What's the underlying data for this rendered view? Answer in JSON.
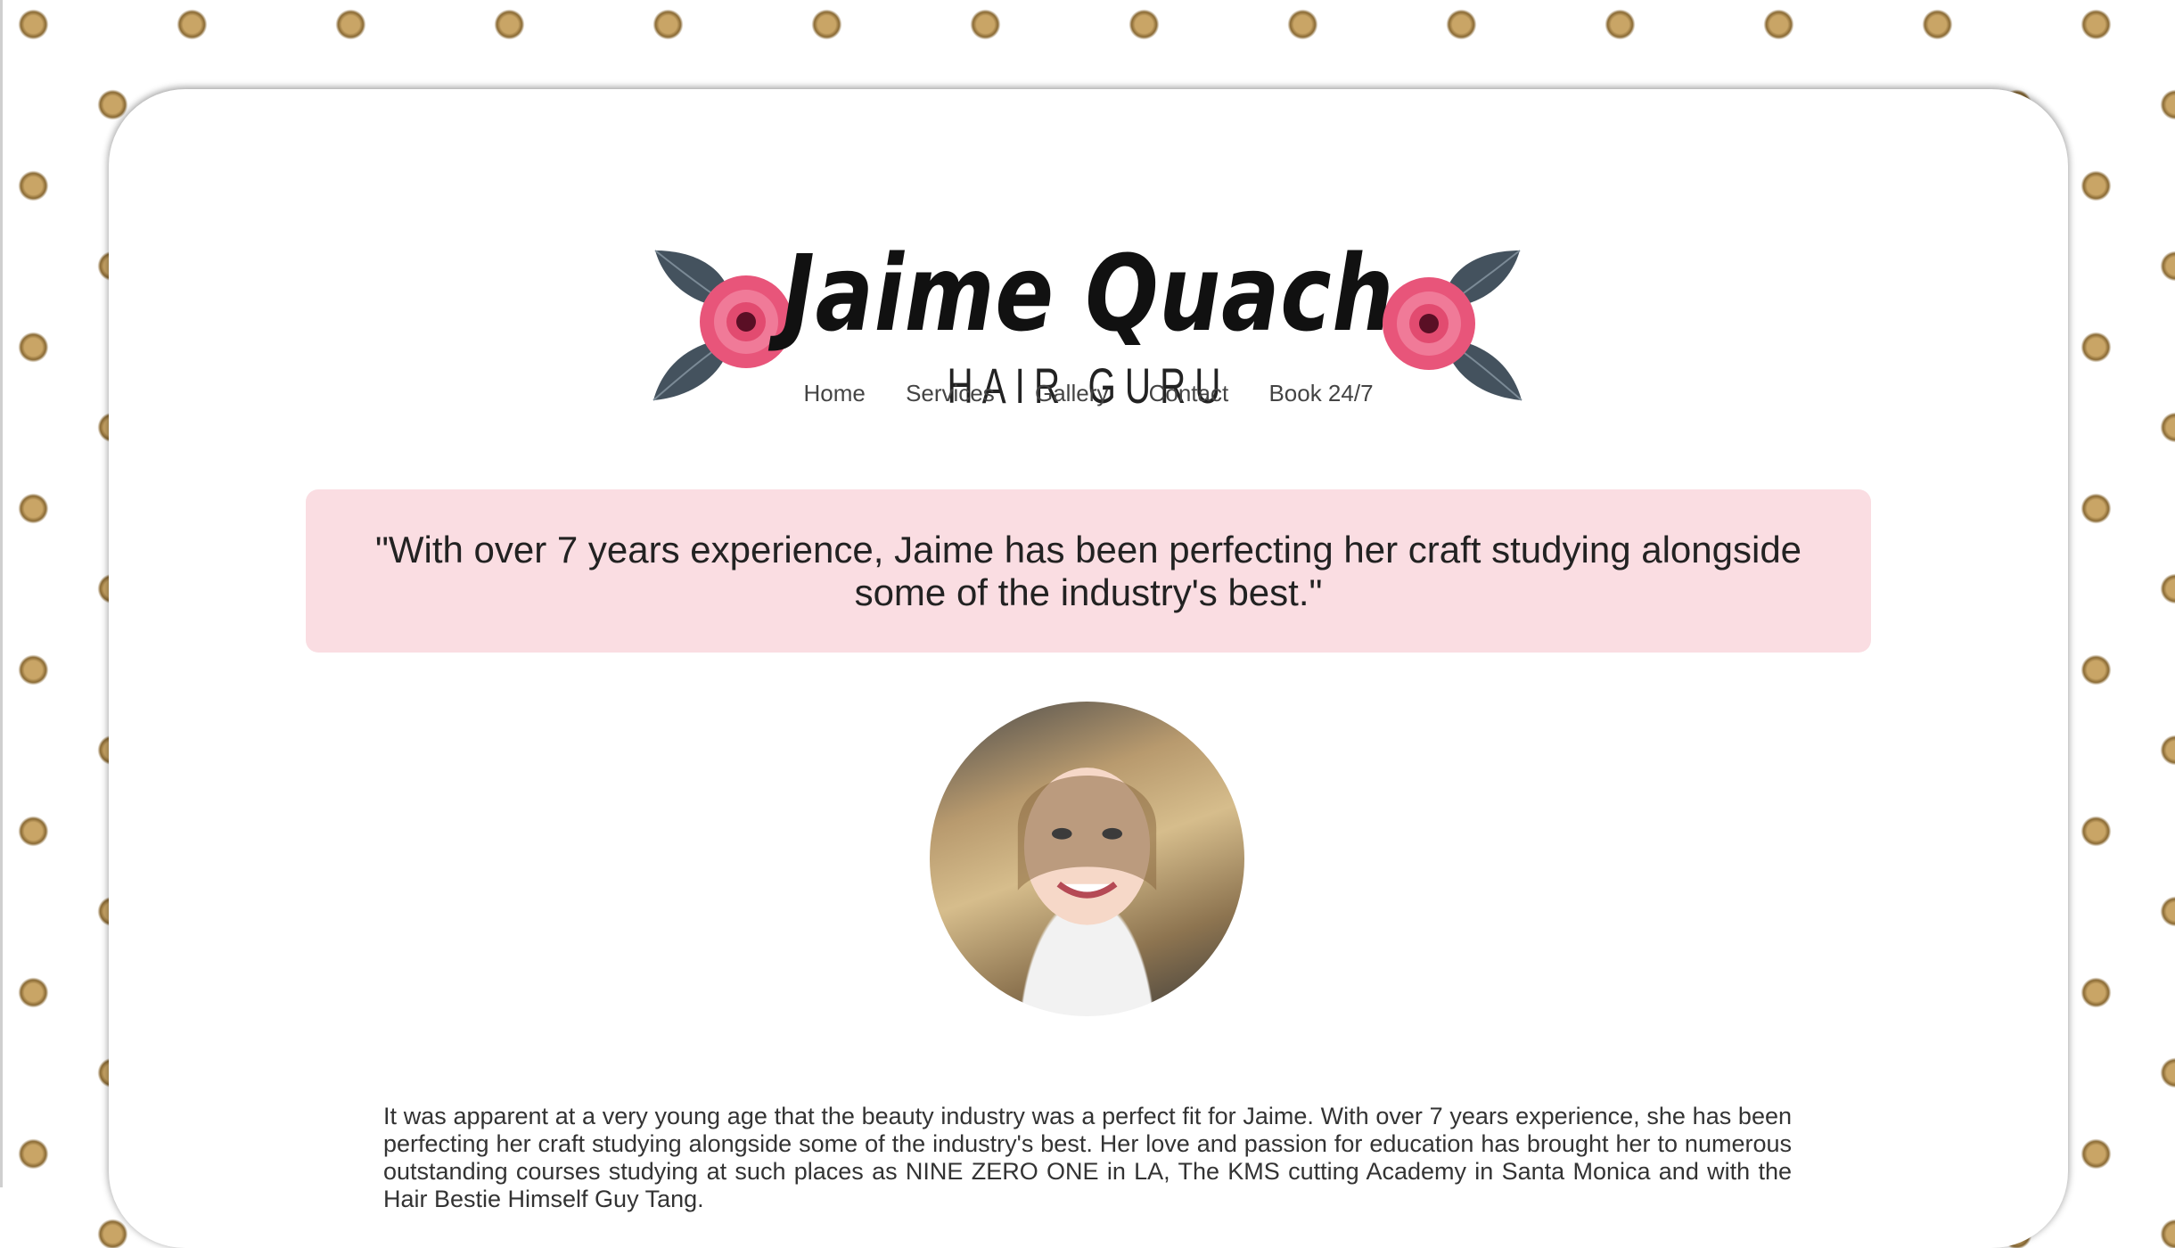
{
  "brand": {
    "name": "Jaime Quach",
    "tagline": "HAIR GURU"
  },
  "nav": {
    "items": [
      {
        "label": "Home"
      },
      {
        "label": "Services"
      },
      {
        "label": "Gallery"
      },
      {
        "label": "Contact"
      },
      {
        "label": "Book 24/7"
      }
    ]
  },
  "quote": {
    "text": "\"With over 7 years experience, Jaime has been perfecting her craft studying alongside some of the industry's best.\""
  },
  "bio": {
    "text": "It was apparent at a very young age that the beauty industry was a perfect fit for Jaime. With over 7 years experience, she has been perfecting her craft studying alongside some of the industry's best. Her love and passion for education has brought her to numerous outstanding courses studying at such places as NINE ZERO ONE in LA, The KMS cutting Academy in Santa Monica and with the Hair Bestie Himself Guy Tang."
  },
  "colors": {
    "quote_background": "#fadde2",
    "dot_gold": "#c9a566",
    "flower_pink": "#e8557a",
    "leaf_slate": "#44525e"
  },
  "icons": {
    "logo_left": "flower-icon",
    "logo_right": "flower-icon"
  }
}
